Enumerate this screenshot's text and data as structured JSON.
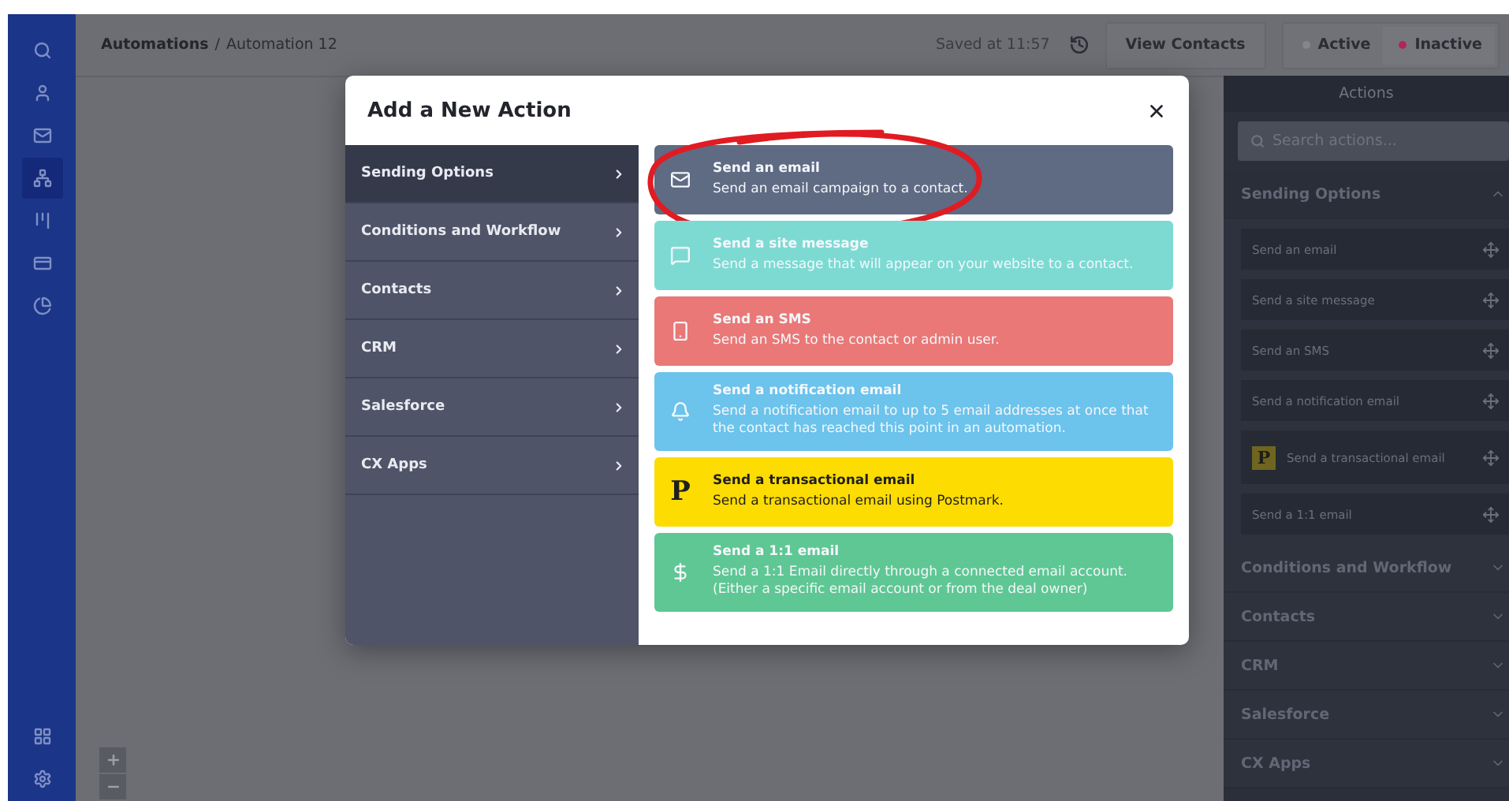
{
  "nav": {
    "items": [
      {
        "kind": "search",
        "selected": false
      },
      {
        "kind": "contacts",
        "selected": false
      },
      {
        "kind": "campaigns",
        "selected": false
      },
      {
        "kind": "automations",
        "selected": true
      },
      {
        "kind": "deals",
        "selected": false
      },
      {
        "kind": "lists",
        "selected": false
      },
      {
        "kind": "reports",
        "selected": false
      }
    ],
    "bottom": [
      {
        "kind": "apps",
        "selected": false
      },
      {
        "kind": "settings",
        "selected": false
      }
    ]
  },
  "header": {
    "breadcrumb": [
      {
        "label": "Automations",
        "current": false
      },
      {
        "label": "Automation 12",
        "current": true
      }
    ],
    "separator": "/",
    "saved": "Saved at 11:57",
    "view_contacts": "View Contacts",
    "status": [
      {
        "label": "Active",
        "selected": false
      },
      {
        "label": "Inactive",
        "selected": true
      }
    ]
  },
  "canvas": {
    "zoom": [
      {
        "kind": "zoom_in"
      },
      {
        "kind": "zoom_out"
      }
    ]
  },
  "modal": {
    "title": "Add a New Action",
    "categories": [
      {
        "label": "Sending Options",
        "selected": true
      },
      {
        "label": "Conditions and Workflow",
        "selected": false
      },
      {
        "label": "Contacts",
        "selected": false
      },
      {
        "label": "CRM",
        "selected": false
      },
      {
        "label": "Salesforce",
        "selected": false
      },
      {
        "label": "CX Apps",
        "selected": false
      }
    ],
    "actions": [
      {
        "kind": "email",
        "title": "Send an email",
        "description": "Send an email campaign to a contact.",
        "color": "#5f6a83",
        "circled": true
      },
      {
        "kind": "site_message",
        "title": "Send a site message",
        "description": "Send a message that will appear on your website to a contact.",
        "color": "#7ddad3",
        "circled": false
      },
      {
        "kind": "sms",
        "title": "Send an SMS",
        "description": "Send an SMS to the contact or admin user.",
        "color": "#e97877",
        "circled": false
      },
      {
        "kind": "notification",
        "title": "Send a notification email",
        "description": "Send a notification email to up to 5 email addresses at once that the contact has reached this point in an automation.",
        "color": "#6cc3ec",
        "circled": false
      },
      {
        "kind": "transactional",
        "title": "Send a transactional email",
        "description": "Send a transactional email using Postmark.",
        "color": "#fddc02",
        "circled": false,
        "logo": "P"
      },
      {
        "kind": "one_to_one",
        "title": "Send a 1:1 email",
        "description": "Send a 1:1 Email directly through a connected email account. (Either a specific email account or from the deal owner)",
        "color": "#5ec794",
        "circled": false
      }
    ]
  },
  "panel": {
    "title": "Actions",
    "search": {
      "placeholder": "Search actions..."
    },
    "sections": [
      {
        "label": "Sending Options",
        "expanded": true,
        "items": [
          {
            "label": "Send an email"
          },
          {
            "label": "Send a site message"
          },
          {
            "label": "Send an SMS"
          },
          {
            "label": "Send a notification email"
          },
          {
            "label": "Send a transactional email",
            "logo": "P"
          },
          {
            "label": "Send a 1:1 email"
          }
        ]
      },
      {
        "label": "Conditions and Workflow",
        "expanded": false
      },
      {
        "label": "Contacts",
        "expanded": false
      },
      {
        "label": "CRM",
        "expanded": false
      },
      {
        "label": "Salesforce",
        "expanded": false
      },
      {
        "label": "CX Apps",
        "expanded": false
      }
    ]
  }
}
